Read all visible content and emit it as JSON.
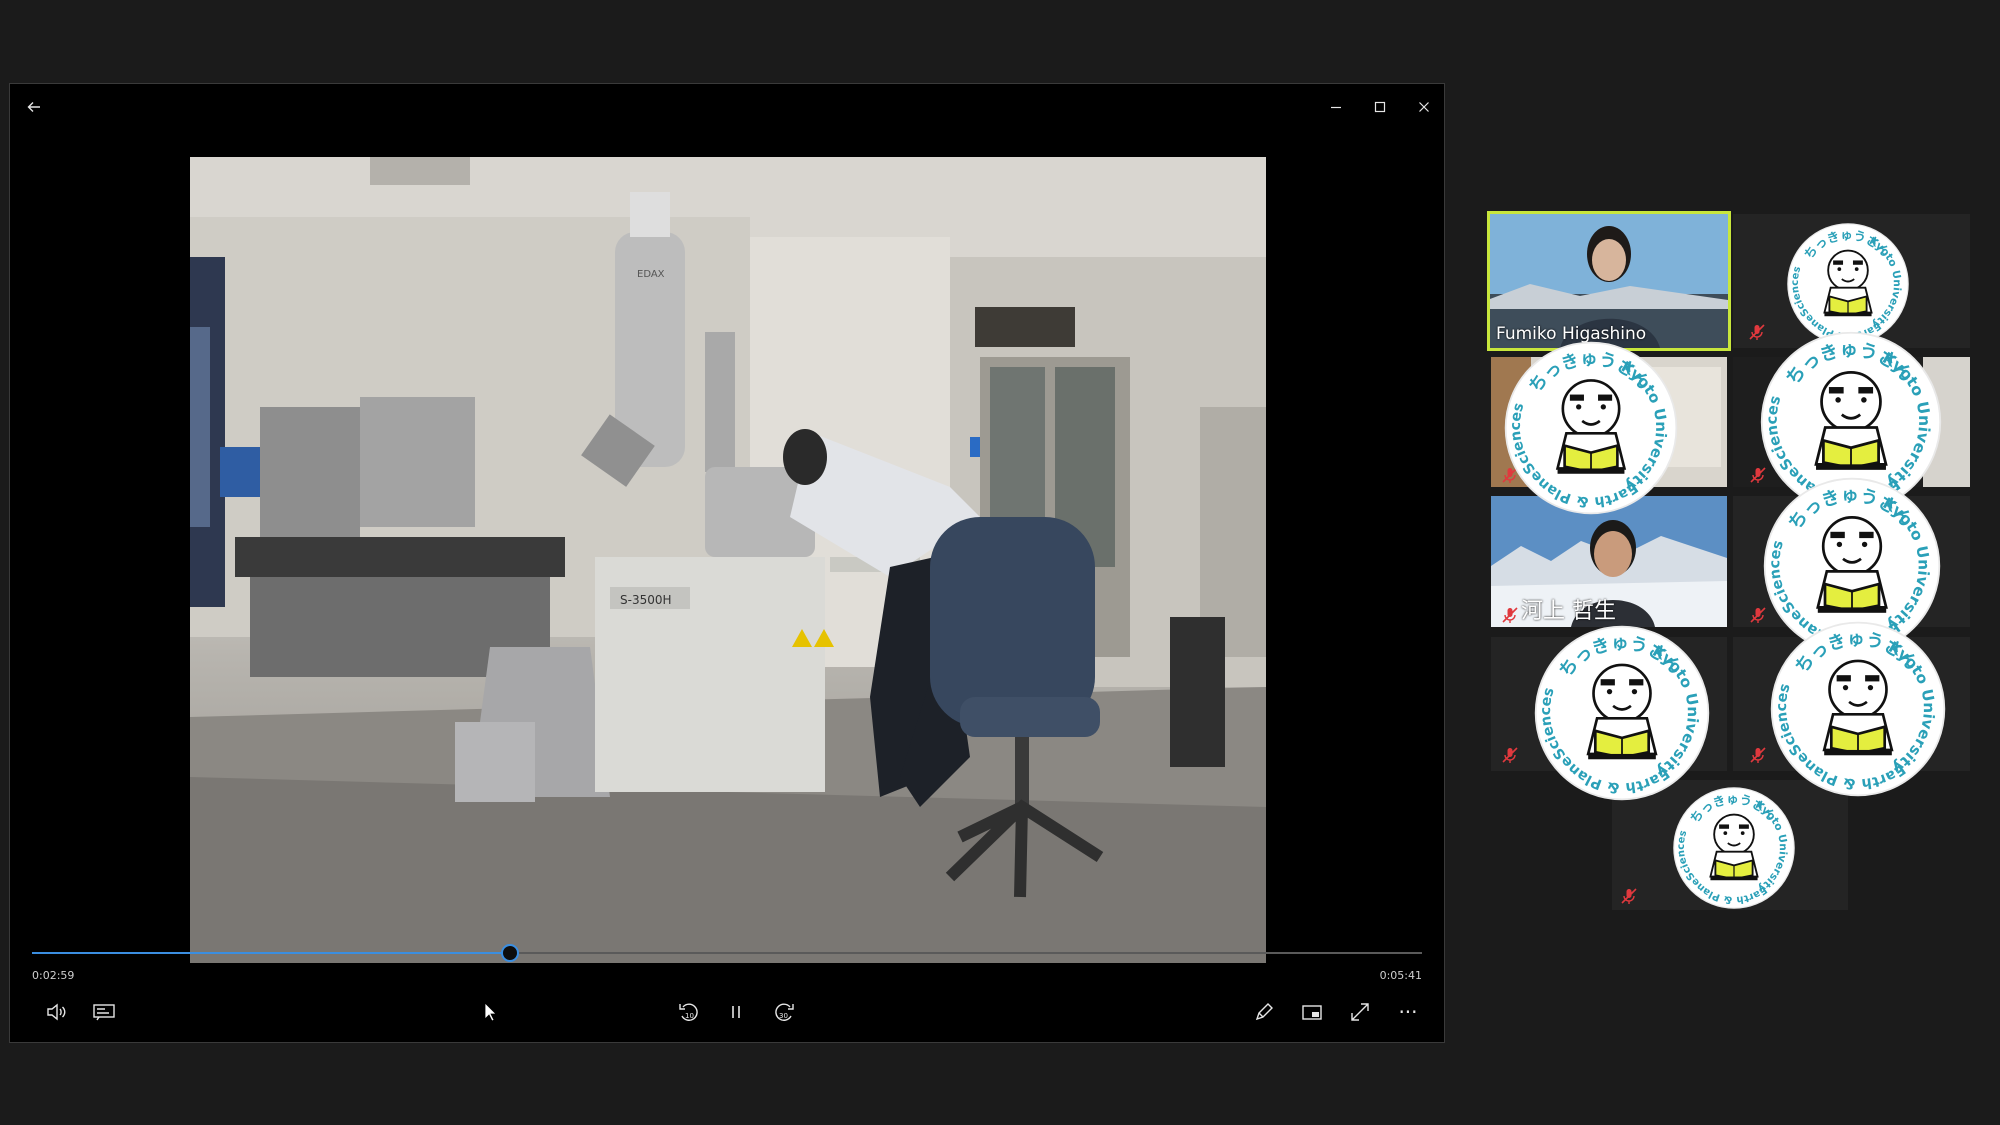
{
  "player": {
    "back_icon": "arrow-left-icon",
    "window_controls": [
      "minimize-icon",
      "maximize-icon",
      "close-icon"
    ],
    "current_time": "0:02:59",
    "total_time": "0:05:41",
    "progress": 0.344,
    "accent_color": "#3b8ee0",
    "controls_left": [
      "volume-icon",
      "captions-icon"
    ],
    "controls_center": [
      "skip-back-10-icon",
      "pause-icon",
      "skip-forward-30-icon"
    ],
    "controls_right": [
      "pen-icon",
      "mini-view-icon",
      "fullscreen-icon",
      "more-icon"
    ],
    "rewind_label": "10",
    "forward_label": "30",
    "more_label": "···",
    "lab_labels": {
      "edax": "EDAX",
      "model": "S-3500H"
    }
  },
  "gallery": {
    "active_speaker_color": "#c8e63c",
    "participants": [
      {
        "name": "Fumiko Higashino",
        "type": "video",
        "active": true
      },
      {
        "name": "",
        "type": "logo"
      },
      {
        "name": "",
        "type": "video-logo"
      },
      {
        "name": "",
        "type": "video-logo"
      },
      {
        "name": "河上 哲生",
        "type": "video"
      },
      {
        "name": "",
        "type": "logo"
      },
      {
        "name": "",
        "type": "logo"
      },
      {
        "name": "",
        "type": "logo"
      },
      {
        "name": "",
        "type": "logo"
      }
    ],
    "logo_text": {
      "top": "ちっきゅうさん",
      "right": "Kyoto University",
      "bottom": "Earth & Planetary",
      "left": "Sciences"
    },
    "logo_color": "#2aa0b8"
  }
}
